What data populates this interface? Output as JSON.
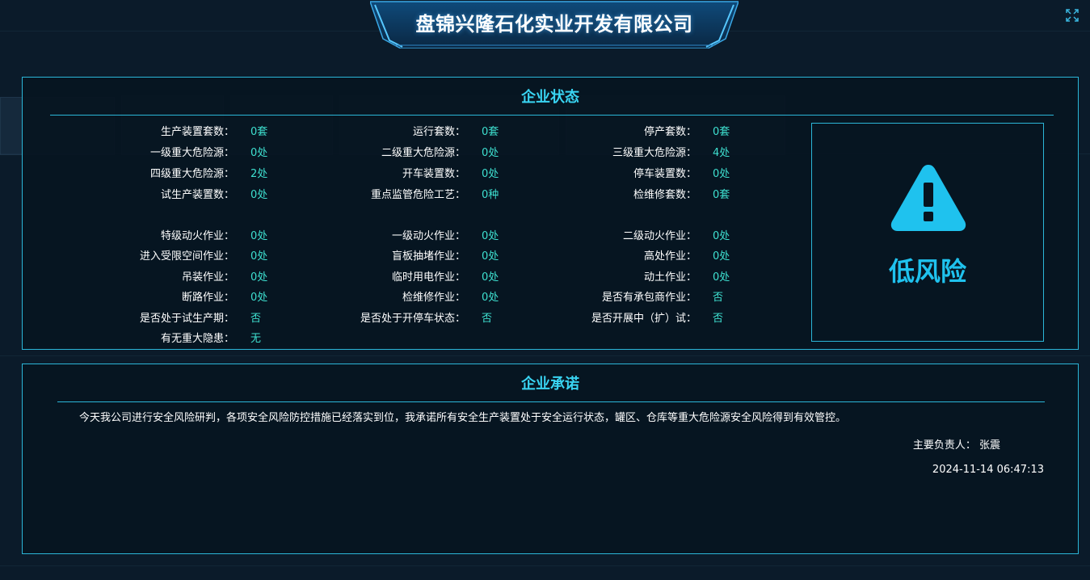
{
  "header": {
    "title": "盘锦兴隆石化实业开发有限公司"
  },
  "status": {
    "title": "企业状态",
    "rows": [
      [
        {
          "label": "生产装置套数：",
          "value": "0套"
        },
        {
          "label": "运行套数：",
          "value": "0套"
        },
        {
          "label": "停产套数：",
          "value": "0套"
        }
      ],
      [
        {
          "label": "一级重大危险源：",
          "value": "0处"
        },
        {
          "label": "二级重大危险源：",
          "value": "0处"
        },
        {
          "label": "三级重大危险源：",
          "value": "4处"
        }
      ],
      [
        {
          "label": "四级重大危险源：",
          "value": "2处"
        },
        {
          "label": "开车装置数：",
          "value": "0处"
        },
        {
          "label": "停车装置数：",
          "value": "0处"
        }
      ],
      [
        {
          "label": "试生产装置数：",
          "value": "0处"
        },
        {
          "label": "重点监管危险工艺：",
          "value": "0种"
        },
        {
          "label": "检维修套数：",
          "value": "0套"
        }
      ],
      [
        {
          "label": "特级动火作业：",
          "value": "0处"
        },
        {
          "label": "一级动火作业：",
          "value": "0处"
        },
        {
          "label": "二级动火作业：",
          "value": "0处"
        }
      ],
      [
        {
          "label": "进入受限空间作业：",
          "value": "0处"
        },
        {
          "label": "盲板抽堵作业：",
          "value": "0处"
        },
        {
          "label": "高处作业：",
          "value": "0处"
        }
      ],
      [
        {
          "label": "吊装作业：",
          "value": "0处"
        },
        {
          "label": "临时用电作业：",
          "value": "0处"
        },
        {
          "label": "动土作业：",
          "value": "0处"
        }
      ],
      [
        {
          "label": "断路作业：",
          "value": "0处"
        },
        {
          "label": "检维修作业：",
          "value": "0处"
        },
        {
          "label": "是否有承包商作业：",
          "value": "否"
        }
      ],
      [
        {
          "label": "是否处于试生产期：",
          "value": "否"
        },
        {
          "label": "是否处于开停车状态：",
          "value": "否"
        },
        {
          "label": "是否开展中（扩）试：",
          "value": "否"
        }
      ],
      [
        {
          "label": "有无重大隐患：",
          "value": "无"
        }
      ]
    ],
    "risk": {
      "label": "低风险",
      "icon": "warning-icon",
      "color": "#1fc2ee"
    }
  },
  "promise": {
    "title": "企业承诺",
    "text": "今天我公司进行安全风险研判，各项安全风险防控措施已经落实到位，我承诺所有安全生产装置处于安全运行状态，罐区、仓库等重大危险源安全风险得到有效管控。",
    "person_label": "主要负责人：",
    "person_name": "张震",
    "timestamp": "2024-11-14 06:47:13"
  },
  "colors": {
    "accent": "#2bb6d8",
    "value": "#3ee0d0",
    "title": "#39d4f2",
    "background": "#0b1b2a"
  }
}
